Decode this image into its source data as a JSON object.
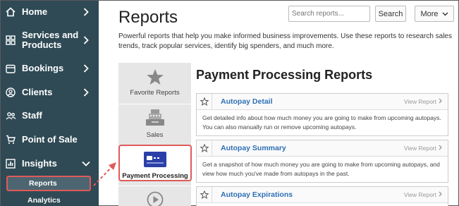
{
  "sidebar": {
    "items": [
      {
        "label": "Home",
        "icon": "home-icon"
      },
      {
        "label": "Services and Products",
        "icon": "grid-icon"
      },
      {
        "label": "Bookings",
        "icon": "calendar-icon"
      },
      {
        "label": "Clients",
        "icon": "user-circle-icon"
      },
      {
        "label": "Staff",
        "icon": "people-icon"
      },
      {
        "label": "Point of Sale",
        "icon": "cart-icon"
      },
      {
        "label": "Insights",
        "icon": "chart-icon"
      }
    ],
    "sub_items": [
      {
        "label": "Reports",
        "active": true
      },
      {
        "label": "Analytics",
        "active": false
      }
    ]
  },
  "header": {
    "title": "Reports",
    "search_placeholder": "Search reports...",
    "search_button": "Search",
    "more_button": "More"
  },
  "description": "Powerful reports that help you make informed business improvements. Use these reports to research sales trends, track popular services, identify big spenders, and much more.",
  "categories": [
    {
      "label": "Favorite Reports",
      "icon": "star-icon"
    },
    {
      "label": "Sales",
      "icon": "cash-register-icon"
    },
    {
      "label": "Payment Processing",
      "icon": "credit-card-icon",
      "active": true
    },
    {
      "label": "",
      "icon": "play-icon"
    }
  ],
  "panel": {
    "title": "Payment Processing Reports",
    "reports": [
      {
        "name": "Autopay Detail",
        "view": "View Report",
        "desc": "Get detailed info about how much money you are going to make from upcoming autopays. You can also manually run or remove upcoming autopays."
      },
      {
        "name": "Autopay Summary",
        "view": "View Report",
        "desc": "Get a snapshot of how much money you are going to make from upcoming autopays, and view how much you've made from autopays in the past."
      },
      {
        "name": "Autopay Expirations",
        "view": "View Report",
        "desc": ""
      }
    ]
  },
  "colors": {
    "sidebar_bg": "#2f4a55",
    "highlight": "#e05a5a",
    "link": "#2e6fb5",
    "card_icon": "#2b3fa8"
  }
}
